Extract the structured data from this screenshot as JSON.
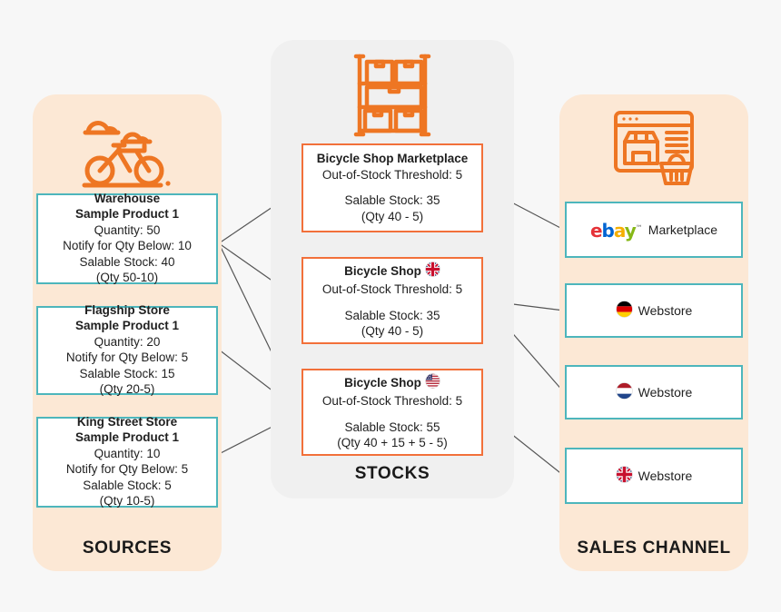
{
  "panels": {
    "sources": {
      "title": "SOURCES",
      "icon": "bicycle-clouds-icon",
      "bg": "#fce8d5",
      "border": "#4db6bc"
    },
    "stocks": {
      "title": "STOCKS",
      "icon": "warehouse-shelf-icon",
      "bg": "#f0f0f0",
      "border": "#f2703a"
    },
    "channels": {
      "title": "SALES CHANNEL",
      "icon": "online-storefront-icon",
      "bg": "#fce8d5",
      "border": "#4db6bc"
    }
  },
  "colors": {
    "page_background": "#f7f7f7",
    "panel_peach": "#fce8d5",
    "panel_gray": "#f0f0f0",
    "teal_border": "#4db6bc",
    "orange_border": "#f2703a",
    "icon_orange": "#ee7623",
    "edge_line": "#555555"
  },
  "sources": [
    {
      "name": "Warehouse",
      "product": "Sample Product 1",
      "quantity": "Quantity: 50",
      "notify": "Notify for Qty Below: 10",
      "salable": "Salable Stock: 40",
      "formula": "(Qty 50-10)"
    },
    {
      "name": "Flagship Store",
      "product": "Sample Product 1",
      "quantity": "Quantity: 20",
      "notify": "Notify for Qty Below: 5",
      "salable": "Salable Stock: 15",
      "formula": "(Qty 20-5)"
    },
    {
      "name": "King Street Store",
      "product": "Sample Product 1",
      "quantity": "Quantity: 10",
      "notify": "Notify for Qty Below: 5",
      "salable": "Salable Stock: 5",
      "formula": "(Qty 10-5)"
    }
  ],
  "stocks": [
    {
      "name": "Bicycle Shop Marketplace",
      "flag": "",
      "threshold": "Out-of-Stock Threshold: 5",
      "salable": "Salable Stock: 35",
      "formula": "(Qty 40 - 5)"
    },
    {
      "name": "Bicycle Shop",
      "flag": "uk-flag-icon",
      "threshold": "Out-of-Stock Threshold: 5",
      "salable": "Salable Stock: 35",
      "formula": "(Qty 40 - 5)"
    },
    {
      "name": "Bicycle Shop",
      "flag": "us-flag-icon",
      "threshold": "Out-of-Stock Threshold: 5",
      "salable": "Salable Stock: 55",
      "formula": "(Qty 40 + 15 + 5 - 5)"
    }
  ],
  "channels": [
    {
      "logo": "ebay-logo",
      "flag": "",
      "label": "Marketplace"
    },
    {
      "logo": "flag",
      "flag": "de-flag-icon",
      "label": "Webstore"
    },
    {
      "logo": "flag",
      "flag": "nl-flag-icon",
      "label": "Webstore"
    },
    {
      "logo": "flag",
      "flag": "uk-flag-icon",
      "label": "Webstore"
    }
  ],
  "ebay_logo": {
    "e": "e",
    "b": "b",
    "a": "a",
    "y": "y",
    "tm": "™"
  },
  "edges": [
    {
      "from": "source-warehouse",
      "to": "stock-marketplace"
    },
    {
      "from": "source-warehouse",
      "to": "stock-uk"
    },
    {
      "from": "source-warehouse",
      "to": "stock-us"
    },
    {
      "from": "source-flagship-store",
      "to": "stock-us"
    },
    {
      "from": "source-king-street-store",
      "to": "stock-us"
    },
    {
      "from": "stock-marketplace",
      "to": "channel-ebay-marketplace"
    },
    {
      "from": "stock-uk",
      "to": "channel-de-webstore"
    },
    {
      "from": "stock-uk",
      "to": "channel-nl-webstore"
    },
    {
      "from": "stock-us",
      "to": "channel-uk-webstore"
    }
  ]
}
